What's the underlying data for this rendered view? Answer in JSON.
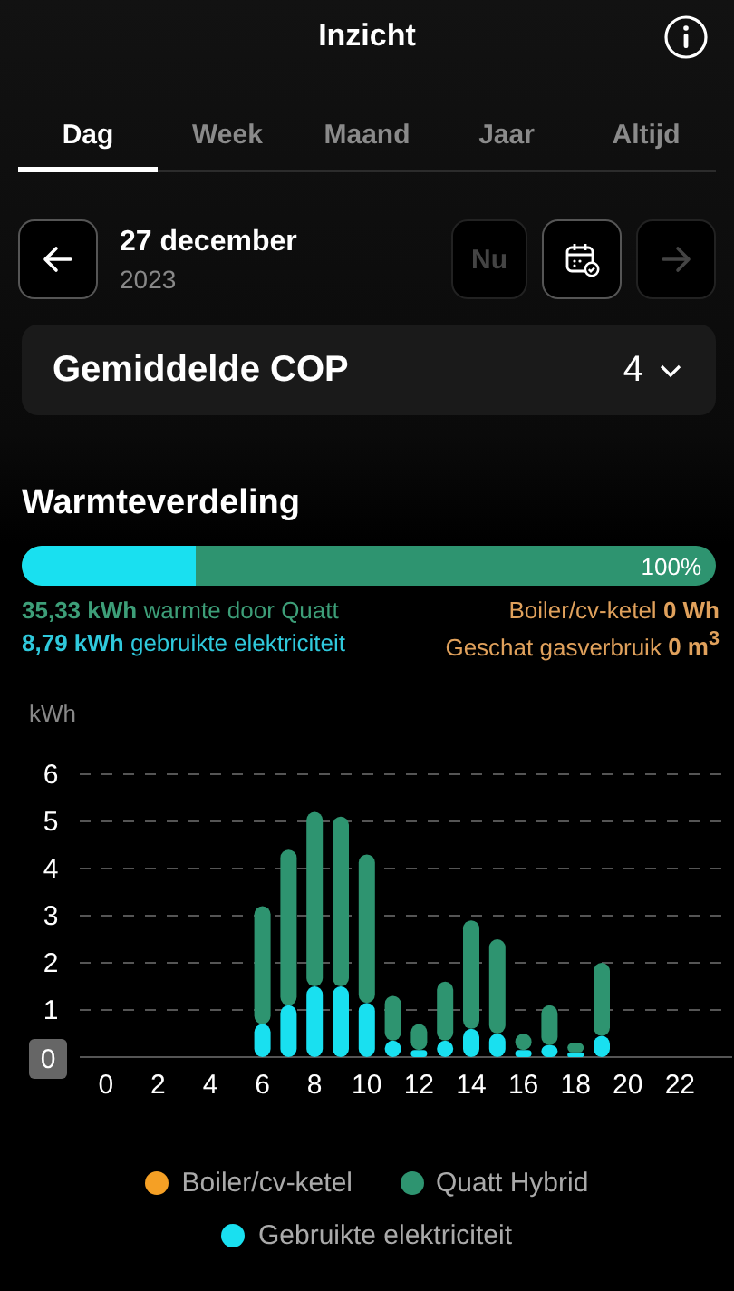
{
  "header": {
    "title": "Inzicht"
  },
  "tabs": [
    {
      "label": "Dag",
      "selected": true
    },
    {
      "label": "Week",
      "selected": false
    },
    {
      "label": "Maand",
      "selected": false
    },
    {
      "label": "Jaar",
      "selected": false
    },
    {
      "label": "Altijd",
      "selected": false
    }
  ],
  "date": {
    "day": "27 december",
    "year": "2023"
  },
  "now_button": {
    "label": "Nu",
    "disabled": true
  },
  "next_button": {
    "disabled": true
  },
  "cop": {
    "label": "Gemiddelde COP",
    "value": "4"
  },
  "distribution": {
    "title": "Warmteverdeling",
    "level": 0.25,
    "percent": "100%",
    "left": [
      {
        "text": "**35,33 kWh** warmte door Quatt",
        "color": "#3d9e78"
      },
      {
        "text": "**8,79 kWh** gebruikte elektriciteit",
        "color": "#2fc9dc"
      }
    ],
    "right": [
      {
        "text": "Boiler/cv-ketel **0 Wh**",
        "color": "#e0a15c"
      },
      {
        "text": "Geschat gasverbruik **0 m$^{3}$**",
        "color": "#e0a15c"
      }
    ]
  },
  "chart": {
    "chart_data": {
      "type": "bar",
      "ylabel": "kWh",
      "stacked": true,
      "x": [
        0,
        1,
        2,
        3,
        4,
        5,
        6,
        7,
        8,
        9,
        10,
        11,
        12,
        13,
        14,
        15,
        16,
        17,
        18,
        19,
        20,
        21,
        22,
        23
      ],
      "xlim": [
        -1,
        24
      ],
      "ylim": [
        0,
        6
      ],
      "grid": true,
      "xticks": [
        0,
        2,
        4,
        6,
        8,
        10,
        12,
        14,
        16,
        18,
        20,
        22
      ],
      "yticks": [
        0,
        1,
        2,
        3,
        4,
        5,
        6
      ],
      "series": [
        {
          "name": "Boiler/cv-ketel",
          "color": "#f5a025",
          "values": [
            0,
            0,
            0,
            0,
            0,
            0,
            0,
            0,
            0,
            0,
            0,
            0,
            0,
            0,
            0,
            0,
            0,
            0,
            0,
            0,
            0,
            0,
            0,
            0
          ]
        },
        {
          "name": "Quatt Hybrid",
          "color": "#2e9470",
          "values": [
            0,
            0,
            0,
            0,
            0,
            0,
            2.5,
            3.3,
            3.7,
            3.6,
            3.15,
            0.95,
            0.55,
            1.25,
            2.3,
            2.0,
            0.35,
            0.85,
            0.2,
            1.55,
            0,
            0,
            0,
            0
          ]
        },
        {
          "name": "Gebruikte elektriciteit",
          "color": "#19e0f0",
          "values": [
            0,
            0,
            0,
            0,
            0,
            0,
            0.7,
            1.1,
            1.5,
            1.5,
            1.15,
            0.35,
            0.15,
            0.35,
            0.6,
            0.5,
            0.15,
            0.25,
            0.1,
            0.45,
            0,
            0,
            0,
            0
          ]
        }
      ]
    }
  }
}
